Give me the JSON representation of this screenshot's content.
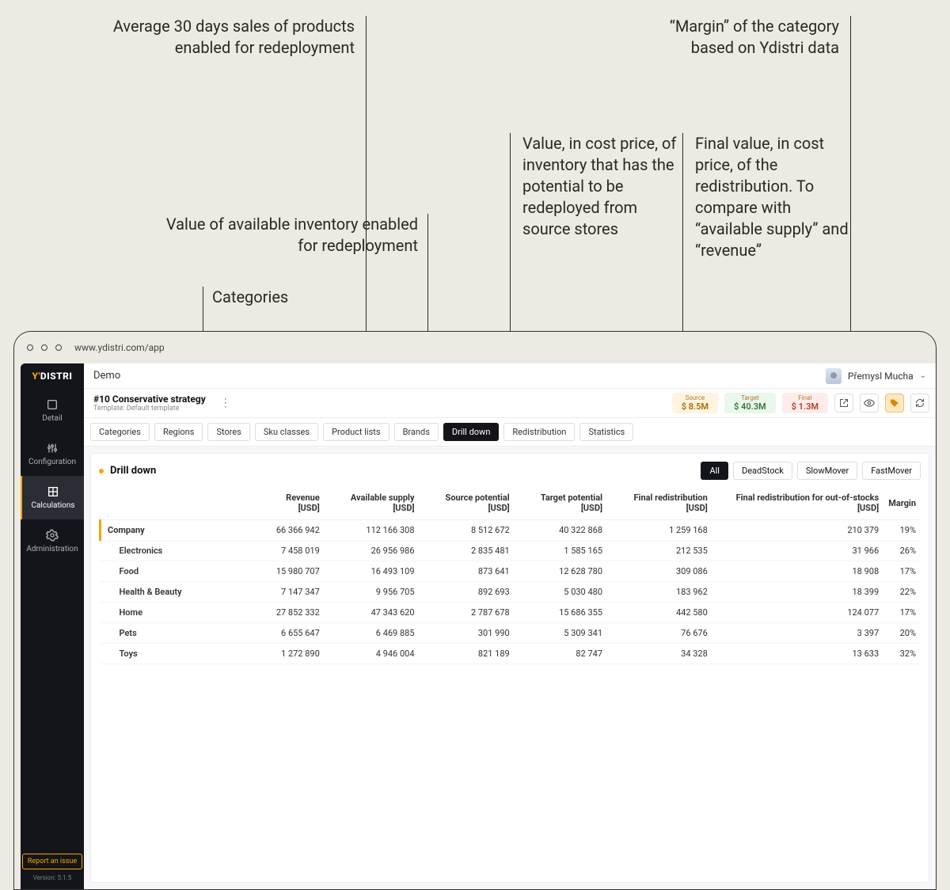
{
  "annotations": {
    "revenue": "Average 30 days sales of products\nenabled for redeployment",
    "margin": "“Margin” of the category\nbased on Ydistri data",
    "supply": "Value of available inventory\nenabled for redeployment",
    "source": "Value, in cost price, of inventory that has the potential to be redeployed from source stores",
    "final": "Final value, in cost price, of the redistribution. To compare with “available supply” and “revenue”",
    "categories": "Categories"
  },
  "browser": {
    "url": "www.ydistri.com/app"
  },
  "sidebar": {
    "brand_y": "Y'",
    "brand_d": "DISTRI",
    "items": [
      {
        "label": "Detail"
      },
      {
        "label": "Configuration"
      },
      {
        "label": "Calculations"
      },
      {
        "label": "Administration"
      }
    ],
    "report": "Report an issue",
    "version": "Version: 5.1.5"
  },
  "topbar": {
    "title": "Demo",
    "user": "Přemysl Mucha"
  },
  "strategy": {
    "title": "#10 Conservative strategy",
    "template_label": "Template:",
    "template_value": "Default template",
    "metrics": {
      "source": {
        "label": "Source",
        "value": "$ 8.5M"
      },
      "target": {
        "label": "Target",
        "value": "$ 40.3M"
      },
      "final": {
        "label": "Final",
        "value": "$ 1.3M"
      }
    }
  },
  "tabs": [
    "Categories",
    "Regions",
    "Stores",
    "Sku classes",
    "Product lists",
    "Brands",
    "Drill down",
    "Redistribution",
    "Statistics"
  ],
  "active_tab": "Drill down",
  "panel": {
    "title": "Drill down",
    "filters": [
      "All",
      "DeadStock",
      "SlowMover",
      "FastMover"
    ],
    "active_filter": "All",
    "columns": [
      "",
      "Revenue [USD]",
      "Available supply [USD]",
      "Source potential [USD]",
      "Target potential [USD]",
      "Final redistribution [USD]",
      "Final redistribution for out-of-stocks [USD]",
      "Margin"
    ],
    "rows": [
      {
        "kind": "company",
        "label": "Company",
        "revenue": "66 366 942",
        "supply": "112 166 308",
        "source": "8 512 672",
        "target": "40 322 868",
        "final": "1 259 168",
        "final_oos": "210 379",
        "margin": "19%"
      },
      {
        "kind": "cat",
        "label": "Electronics",
        "revenue": "7 458 019",
        "supply": "26 956 986",
        "source": "2 835 481",
        "target": "1 585 165",
        "final": "212 535",
        "final_oos": "31 966",
        "margin": "26%"
      },
      {
        "kind": "cat",
        "label": "Food",
        "revenue": "15 980 707",
        "supply": "16 493 109",
        "source": "873 641",
        "target": "12 628 780",
        "final": "309 086",
        "final_oos": "18 908",
        "margin": "17%"
      },
      {
        "kind": "cat",
        "label": "Health & Beauty",
        "revenue": "7 147 347",
        "supply": "9 956 705",
        "source": "892 693",
        "target": "5 030 480",
        "final": "183 962",
        "final_oos": "18 399",
        "margin": "22%"
      },
      {
        "kind": "cat",
        "label": "Home",
        "revenue": "27 852 332",
        "supply": "47 343 620",
        "source": "2 787 678",
        "target": "15 686 355",
        "final": "442 580",
        "final_oos": "124 077",
        "margin": "17%"
      },
      {
        "kind": "cat",
        "label": "Pets",
        "revenue": "6 655 647",
        "supply": "6 469 885",
        "source": "301 990",
        "target": "5 309 341",
        "final": "76 676",
        "final_oos": "3 397",
        "margin": "20%"
      },
      {
        "kind": "cat",
        "label": "Toys",
        "revenue": "1 272 890",
        "supply": "4 946 004",
        "source": "821 189",
        "target": "82 747",
        "final": "34 328",
        "final_oos": "13 633",
        "margin": "32%"
      }
    ]
  }
}
